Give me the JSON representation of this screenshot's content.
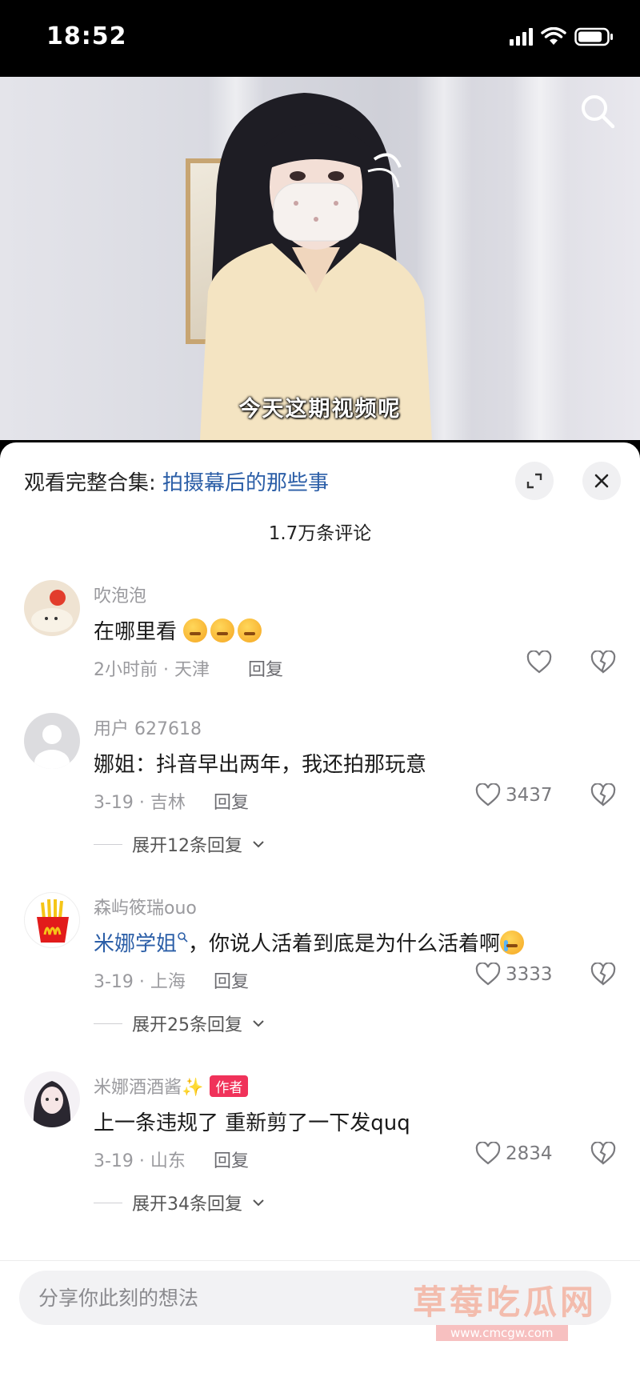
{
  "status_bar": {
    "time": "18:52"
  },
  "video": {
    "subtitle": "今天这期视频呢"
  },
  "sheet": {
    "collection_prefix": "观看完整合集: ",
    "collection_link": "拍摄幕后的那些事",
    "comment_count": "1.7万条评论"
  },
  "comments": [
    {
      "user": "吹泡泡",
      "text": "在哪里看",
      "meta": "2小时前 · 天津",
      "reply": "回复",
      "likes": ""
    },
    {
      "user": "用户 627618",
      "text": "娜姐：抖音早出两年，我还拍那玩意",
      "meta": "3-19 · 吉林",
      "reply": "回复",
      "likes": "3437",
      "expand": "展开12条回复"
    },
    {
      "user": "森屿筱瑞ouo",
      "mention": "米娜学姐",
      "text": "，你说人活着到底是为什么活着啊",
      "meta": "3-19 · 上海",
      "reply": "回复",
      "likes": "3333",
      "expand": "展开25条回复"
    },
    {
      "user": "米娜酒酒酱✨",
      "badge": "作者",
      "text": "上一条违规了 重新剪了一下发quq",
      "meta": "3-19 · 山东",
      "reply": "回复",
      "likes": "2834",
      "expand": "展开34条回复"
    }
  ],
  "input": {
    "placeholder": "分享你此刻的想法"
  },
  "watermark": {
    "title": "草莓吃瓜网",
    "url": "www.cmcgw.com"
  },
  "colors": {
    "link": "#2b5ea7",
    "author_badge": "#f0325a"
  }
}
